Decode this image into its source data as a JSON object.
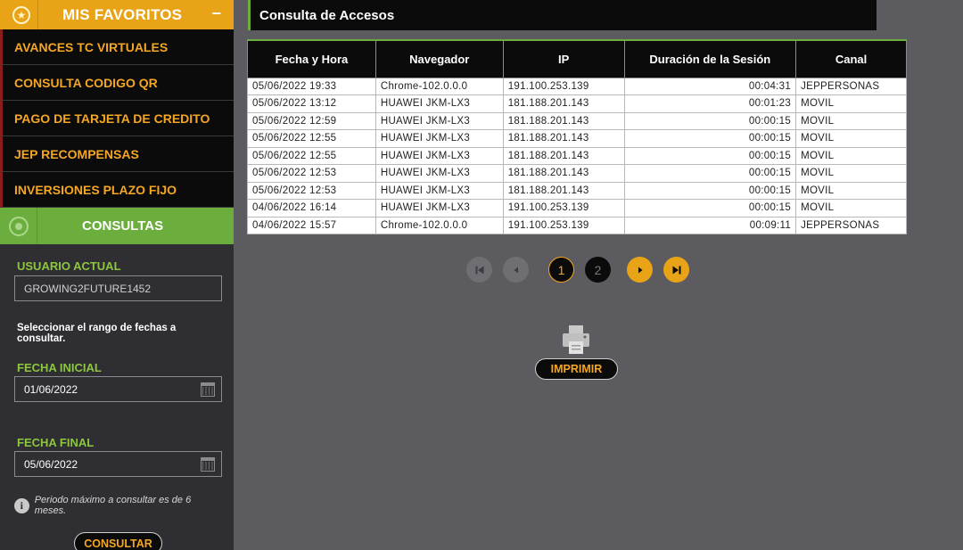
{
  "sidebar": {
    "favorites_title": "MIS FAVORITOS",
    "favorites_collapse": "−",
    "favorites": [
      "AVANCES TC VIRTUALES",
      "CONSULTA CODIGO QR",
      "PAGO DE TARJETA DE CREDITO",
      "JEP RECOMPENSAS",
      "INVERSIONES PLAZO FIJO"
    ],
    "consultas_title": "CONSULTAS",
    "usuario_label": "USUARIO ACTUAL",
    "usuario_value": "GROWING2FUTURE1452",
    "rango_text": "Seleccionar el rango de fechas a consultar.",
    "fecha_inicial_label": "FECHA INICIAL",
    "fecha_inicial_value": "01/06/2022",
    "fecha_final_label": "FECHA FINAL",
    "fecha_final_value": "05/06/2022",
    "note": "Periodo máximo a consultar es de 6 meses.",
    "consultar_button": "CONSULTAR"
  },
  "main": {
    "title": "Consulta de Accesos",
    "columns": [
      "Fecha y Hora",
      "Navegador",
      "IP",
      "Duración de la Sesión",
      "Canal"
    ],
    "rows": [
      [
        "05/06/2022 19:33",
        "Chrome-102.0.0.0",
        "191.100.253.139",
        "00:04:31",
        "JEPPERSONAS"
      ],
      [
        "05/06/2022 13:12",
        "HUAWEI JKM-LX3",
        "181.188.201.143",
        "00:01:23",
        "MOVIL"
      ],
      [
        "05/06/2022 12:59",
        "HUAWEI JKM-LX3",
        "181.188.201.143",
        "00:00:15",
        "MOVIL"
      ],
      [
        "05/06/2022 12:55",
        "HUAWEI JKM-LX3",
        "181.188.201.143",
        "00:00:15",
        "MOVIL"
      ],
      [
        "05/06/2022 12:55",
        "HUAWEI JKM-LX3",
        "181.188.201.143",
        "00:00:15",
        "MOVIL"
      ],
      [
        "05/06/2022 12:53",
        "HUAWEI JKM-LX3",
        "181.188.201.143",
        "00:00:15",
        "MOVIL"
      ],
      [
        "05/06/2022 12:53",
        "HUAWEI JKM-LX3",
        "181.188.201.143",
        "00:00:15",
        "MOVIL"
      ],
      [
        "04/06/2022 16:14",
        "HUAWEI JKM-LX3",
        "191.100.253.139",
        "00:00:15",
        "MOVIL"
      ],
      [
        "04/06/2022 15:57",
        "Chrome-102.0.0.0",
        "191.100.253.139",
        "00:09:11",
        "JEPPERSONAS"
      ]
    ],
    "pages": [
      "1",
      "2"
    ],
    "current_page": "1",
    "print_button": "IMPRIMIR"
  },
  "colors": {
    "accent_orange": "#e8a317",
    "accent_green": "#6cae3e",
    "background": "#5c5b60",
    "sidebar_bg": "#2f2e33"
  },
  "icons": [
    "star-icon",
    "minus-icon",
    "eye-icon",
    "calendar-icon",
    "info-icon",
    "first-page-icon",
    "prev-page-icon",
    "next-page-icon",
    "last-page-icon",
    "printer-icon"
  ]
}
